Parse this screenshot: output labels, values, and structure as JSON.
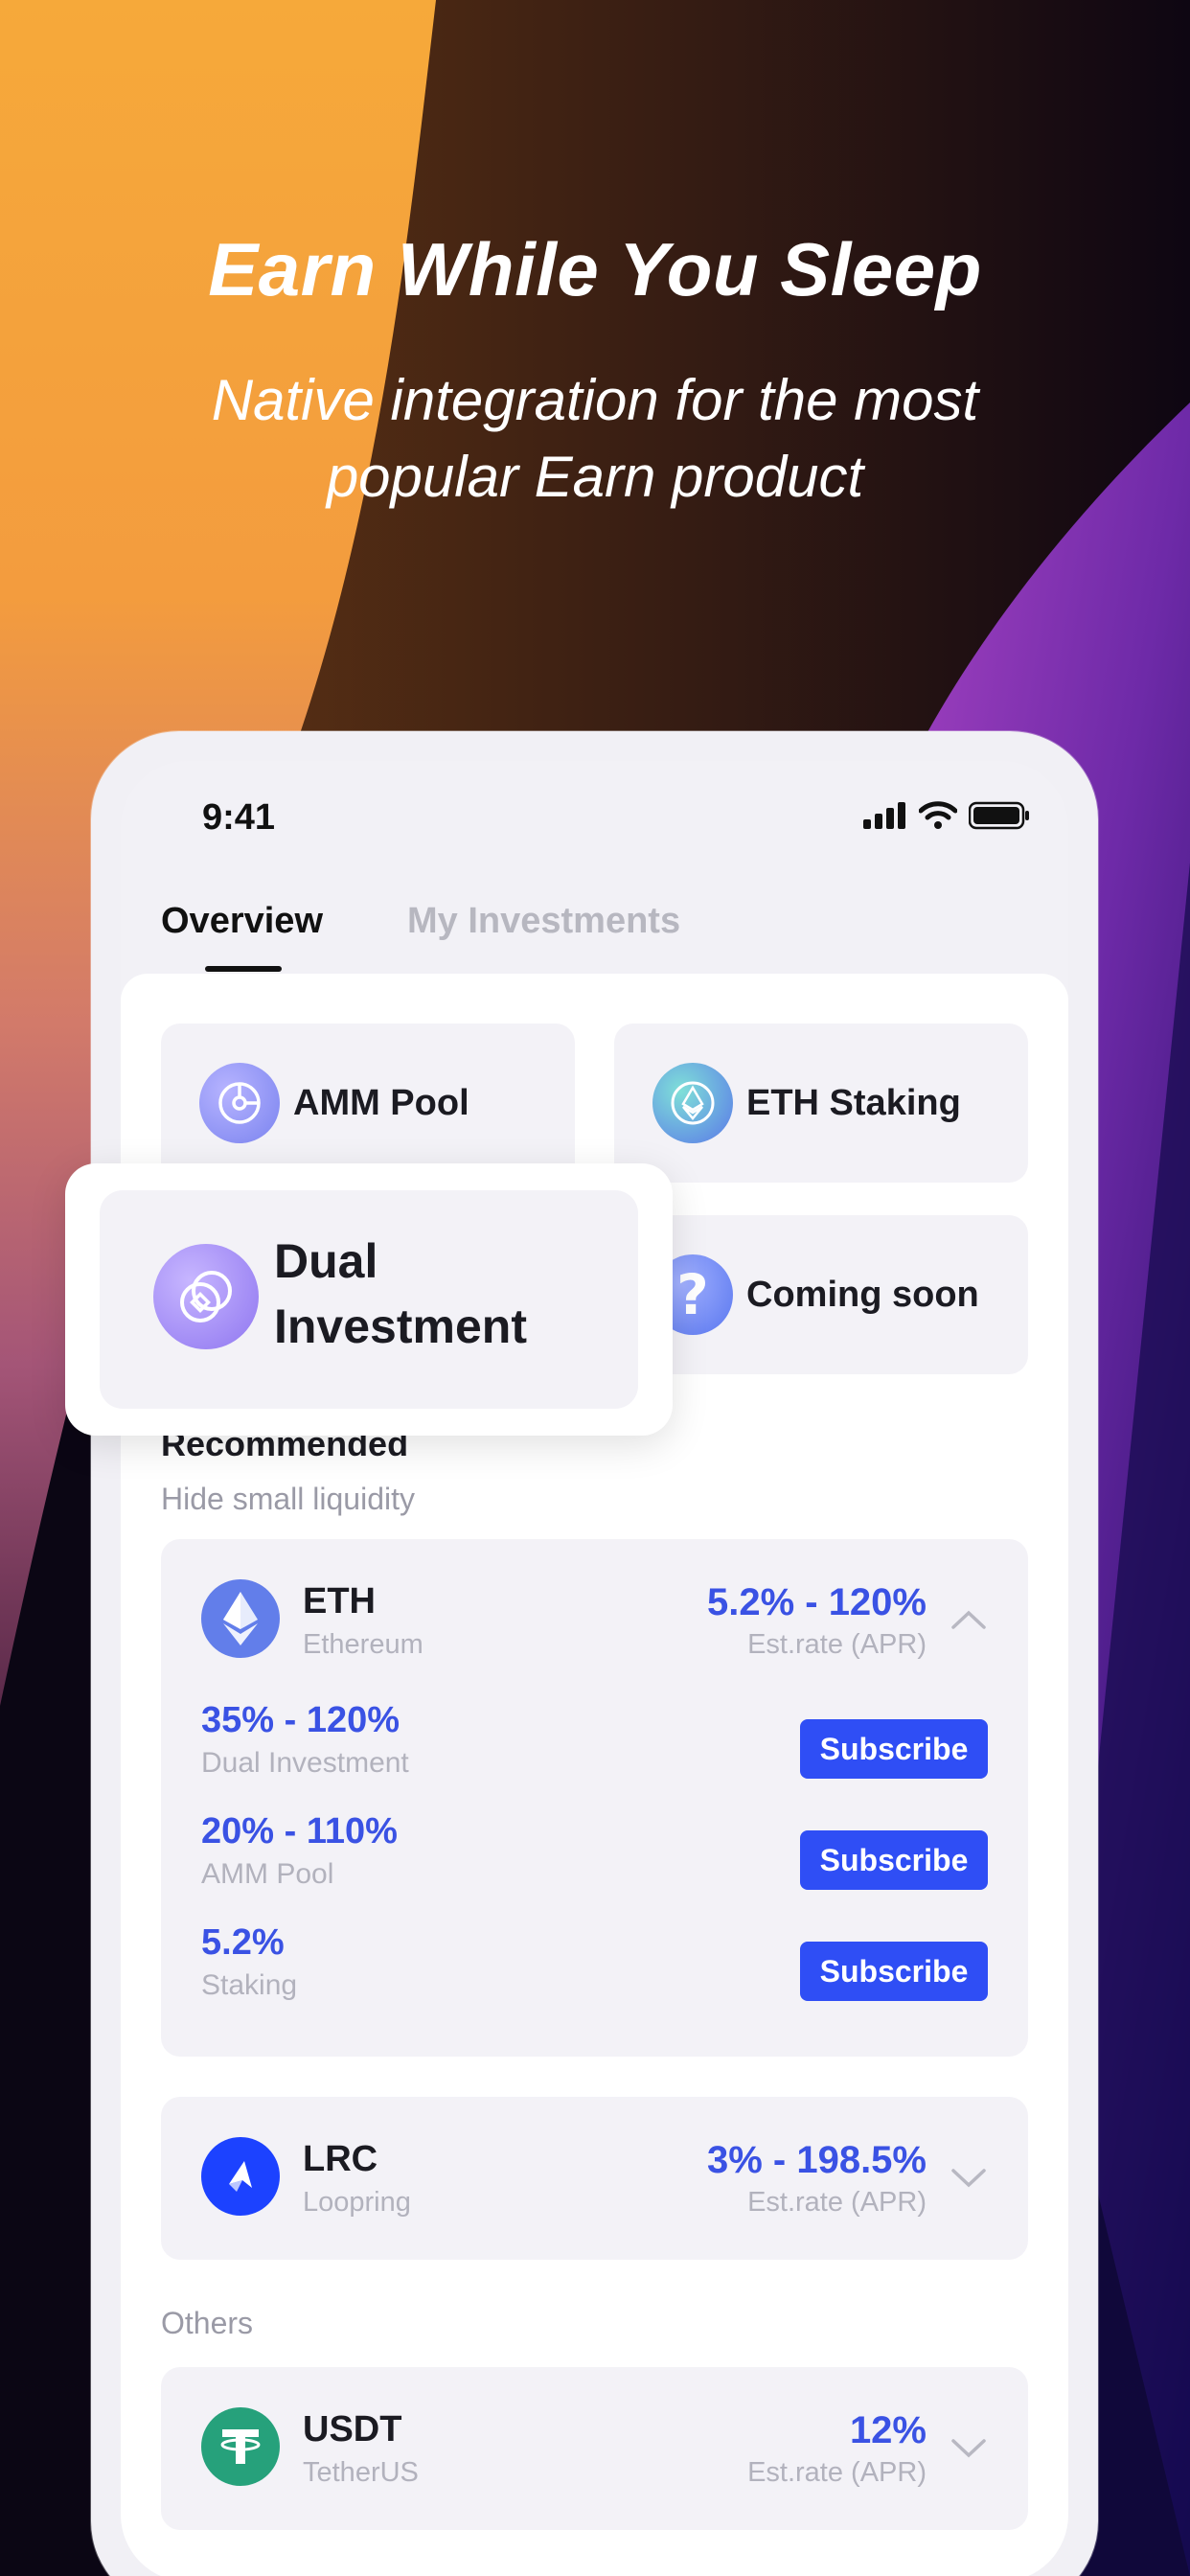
{
  "promo": {
    "headline": "Earn While You Sleep",
    "subline": "Native integration for the most popular Earn product"
  },
  "status_bar": {
    "time": "9:41"
  },
  "tabs": [
    {
      "label": "Overview",
      "active": true
    },
    {
      "label": "My Investments",
      "active": false
    }
  ],
  "products": {
    "amm_pool": "AMM Pool",
    "eth_staking": "ETH Staking",
    "dual_investment": "Dual Investment",
    "coming_soon": "Coming soon"
  },
  "recommended": {
    "title": "Recommended",
    "hide_small": "Hide small liquidity"
  },
  "assets": {
    "eth": {
      "symbol": "ETH",
      "name": "Ethereum",
      "rate": "5.2% - 120%",
      "rate_label": "Est.rate (APR)",
      "expanded": true,
      "items": [
        {
          "rate": "35% - 120%",
          "name": "Dual Investment",
          "button": "Subscribe"
        },
        {
          "rate": "20% - 110%",
          "name": "AMM Pool",
          "button": "Subscribe"
        },
        {
          "rate": "5.2%",
          "name": "Staking",
          "button": "Subscribe"
        }
      ]
    },
    "lrc": {
      "symbol": "LRC",
      "name": "Loopring",
      "rate": "3% - 198.5%",
      "rate_label": "Est.rate (APR)",
      "expanded": false
    },
    "others_title": "Others",
    "usdt": {
      "symbol": "USDT",
      "name": "TetherUS",
      "rate": "12%",
      "rate_label": "Est.rate (APR)",
      "expanded": false
    }
  },
  "colors": {
    "accent": "#3a52e4",
    "button": "#2f4ef5",
    "usdt": "#26a17b",
    "lrc": "#1c42ff",
    "eth": "#627eea"
  }
}
